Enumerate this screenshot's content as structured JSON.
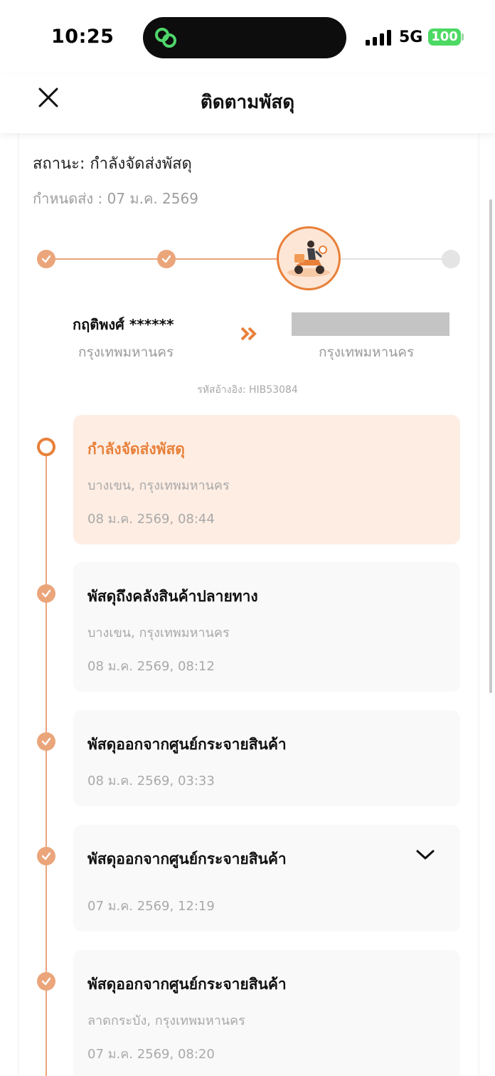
{
  "status_bar": {
    "time": "10:25",
    "network": "5G",
    "battery": "100",
    "icons": [
      "app-link-icon",
      "signal-icon",
      "battery-icon"
    ]
  },
  "header": {
    "title": "ติดตามพัสดุ",
    "close_icon": "close-icon"
  },
  "shipment": {
    "status": "สถานะ: กำลังจัดส่งพัสดุ",
    "due": "กำหนดส่ง : 07 ม.ค. 2569",
    "progress": {
      "steps_total": 4,
      "current_step": 3,
      "current_icon": "courier-scooter-icon"
    },
    "sender": {
      "name": "กฤติพงศ์ ******",
      "city": "กรุงเทพมหานคร"
    },
    "receiver": {
      "city": "กรุงเทพมหานคร"
    },
    "reference": "รหัสอ้างอิง: HIB53084"
  },
  "events": [
    {
      "title": "กำลังจัดส่งพัสดุ",
      "location": "บางเขน, กรุงเทพมหานคร",
      "time": "08 ม.ค. 2569, 08:44",
      "active": true
    },
    {
      "title": "พัสดุถึงคลังสินค้าปลายทาง",
      "location": "บางเขน, กรุงเทพมหานคร",
      "time": "08 ม.ค. 2569, 08:12",
      "active": false
    },
    {
      "title": "พัสดุออกจากศูนย์กระจายสินค้า",
      "location": "",
      "time": "08 ม.ค. 2569, 03:33",
      "active": false
    },
    {
      "title": "พัสดุออกจากศูนย์กระจายสินค้า",
      "location": "",
      "time": "07 ม.ค. 2569, 12:19",
      "active": false,
      "expand_icon": "chevron-down-icon"
    },
    {
      "title": "พัสดุออกจากศูนย์กระจายสินค้า",
      "location": "ลาดกระบัง, กรุงเทพมหานคร",
      "time": "07 ม.ค. 2569, 08:20",
      "active": false
    }
  ],
  "colors": {
    "accent": "#e8803a",
    "accent_light": "#eba57a",
    "active_card_bg": "#fdede3",
    "card_bg": "#f9f9f9",
    "muted_text": "#a9a9a9"
  }
}
